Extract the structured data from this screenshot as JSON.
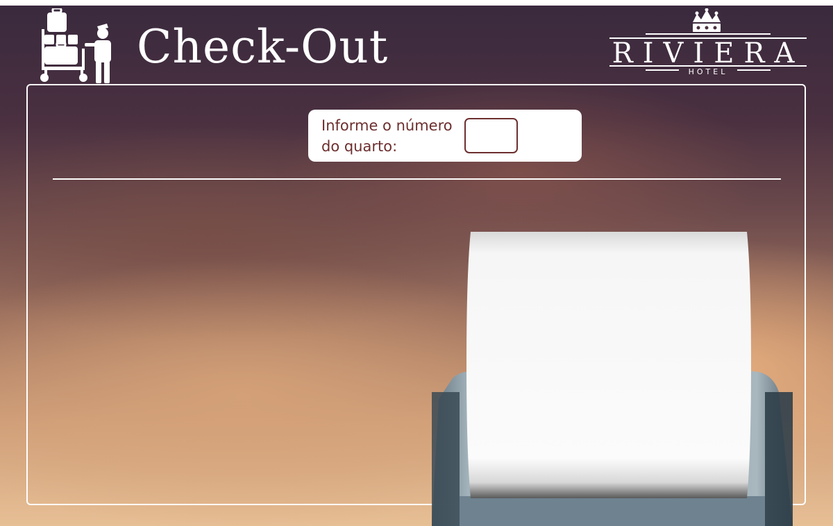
{
  "page": {
    "title": "Check-Out"
  },
  "brand": {
    "name": "RIVIERA",
    "subtitle": "HOTEL"
  },
  "checkout_form": {
    "label": "Informe o número do quarto:",
    "room_number_value": ""
  },
  "icons": {
    "header": "bellboy-luggage-cart-icon",
    "logo_crown": "crown-icon",
    "printer": "receipt-printer-icon"
  },
  "colors": {
    "accent": "#6d2e2e",
    "panel_border": "#ffffff",
    "title": "#ffffff"
  }
}
